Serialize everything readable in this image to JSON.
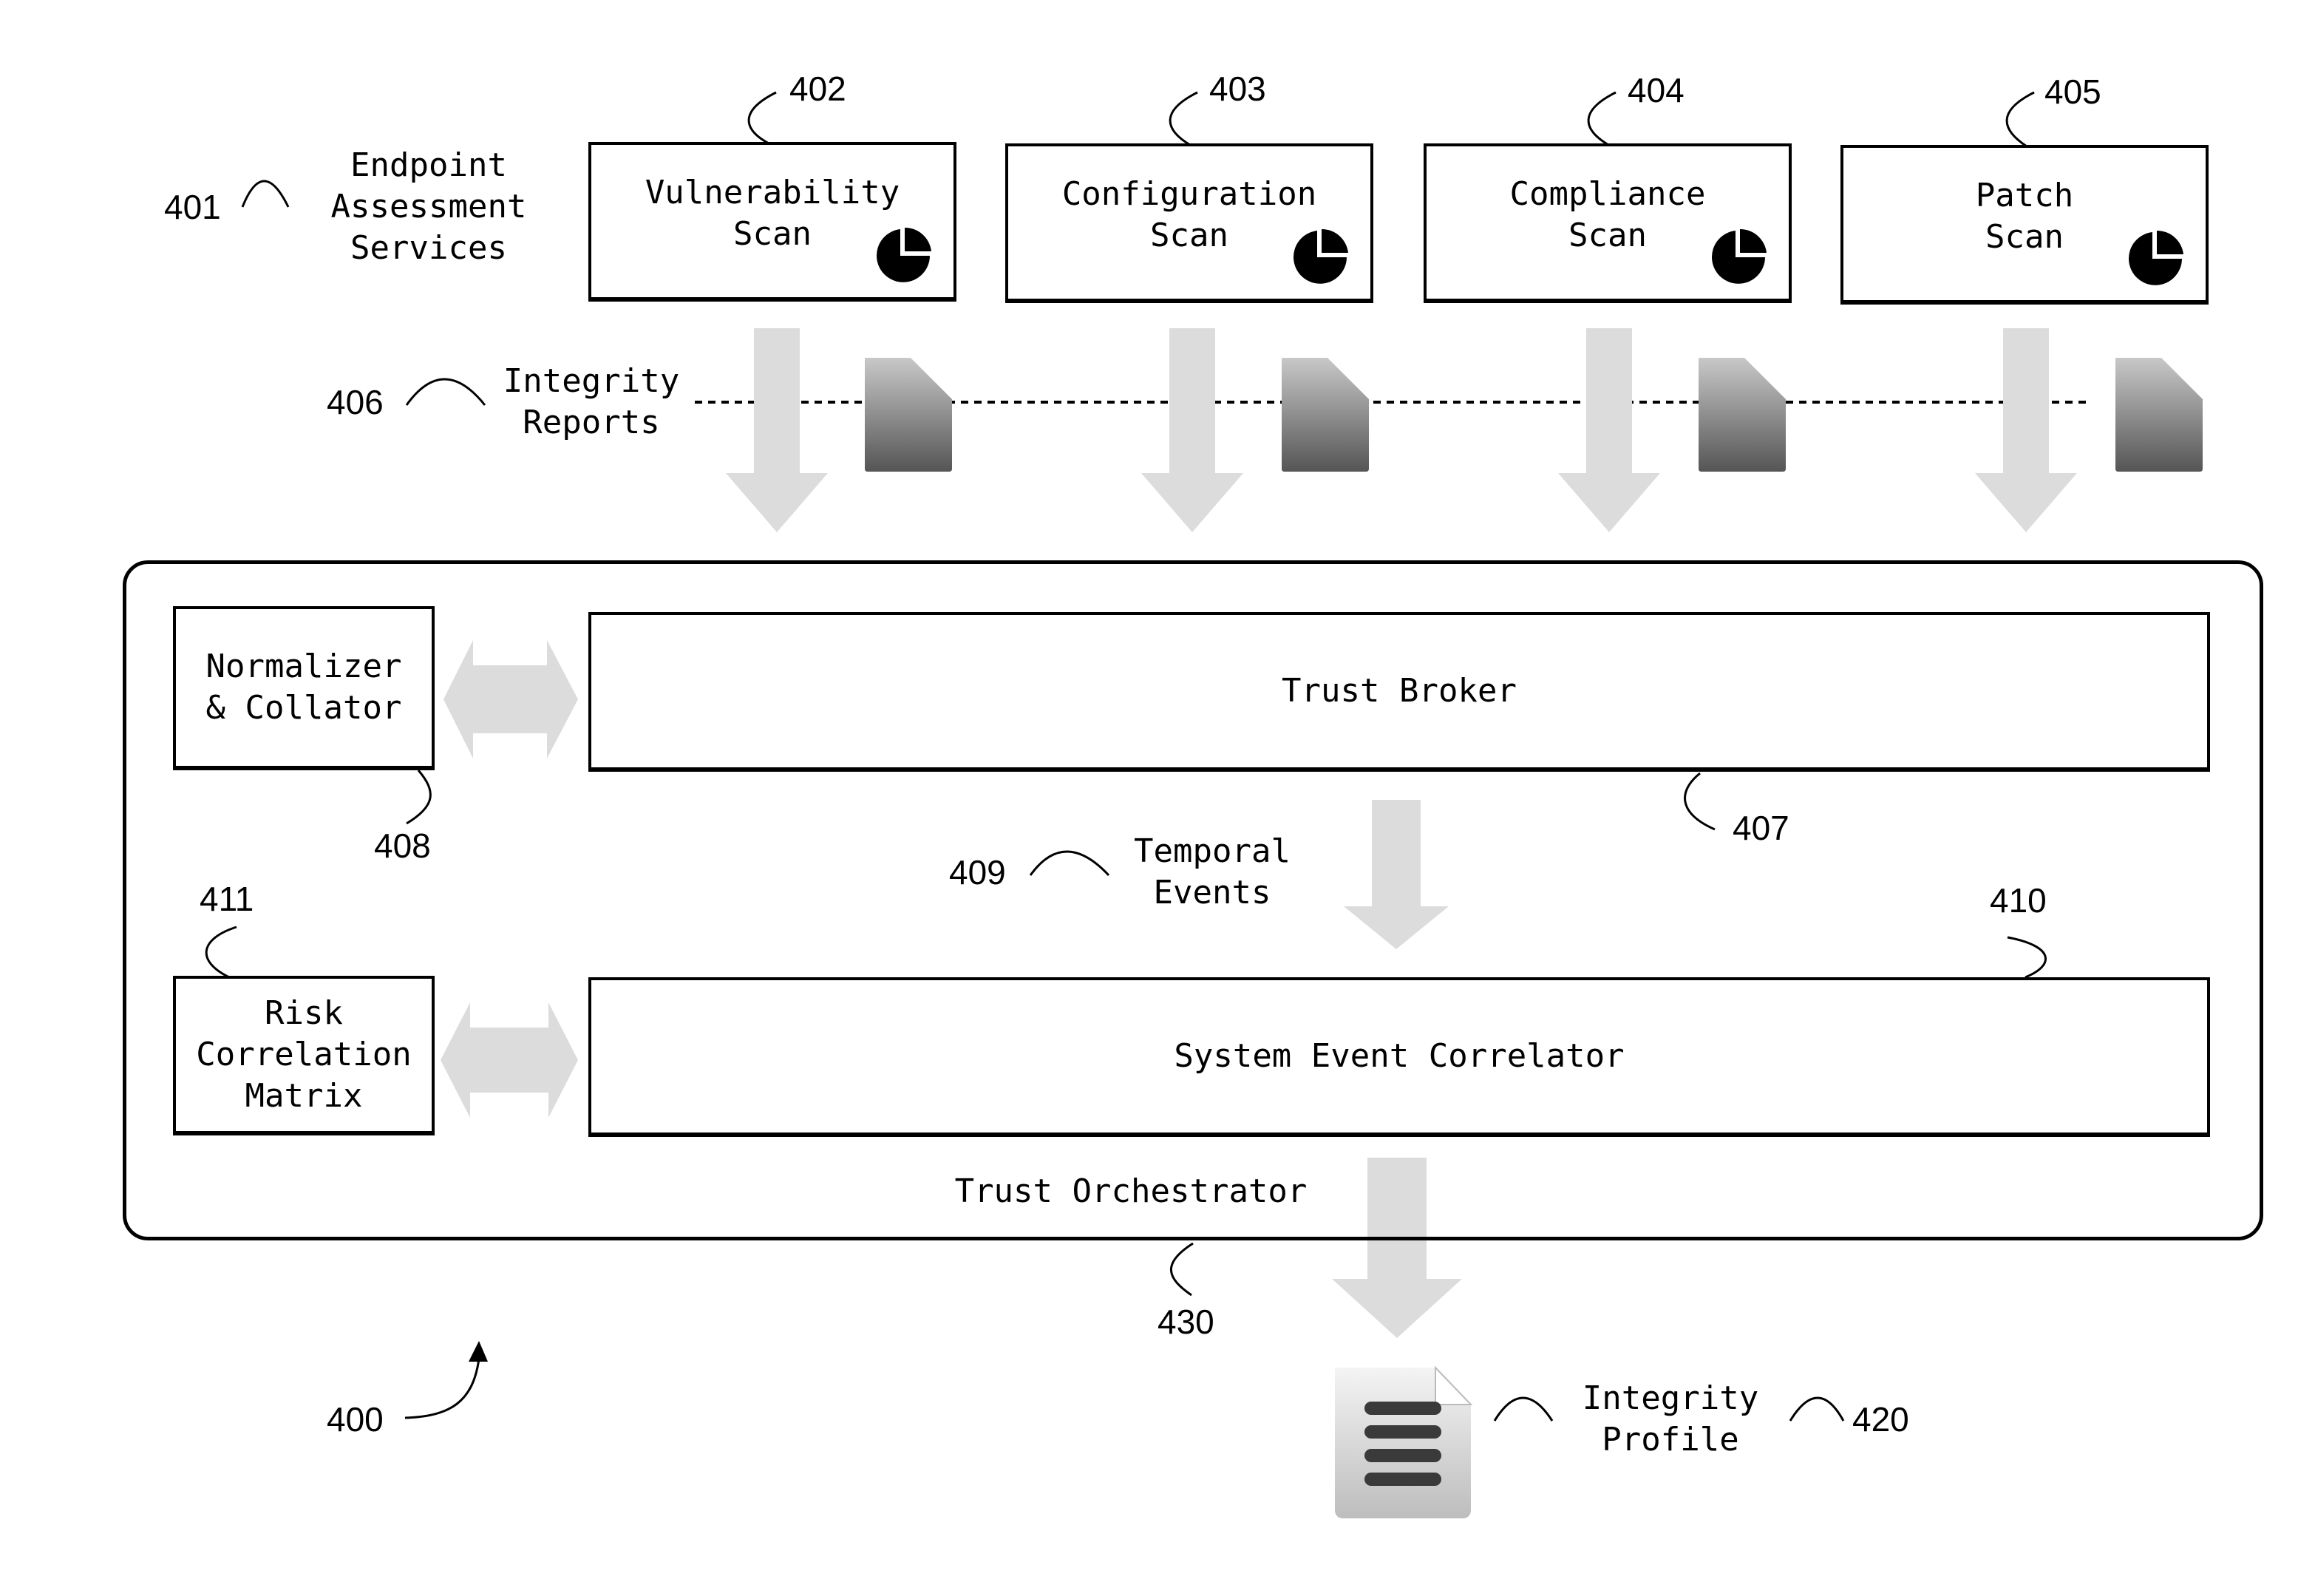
{
  "diagram": {
    "figure_ref": "400",
    "assessment": {
      "ref": "401",
      "label": "Endpoint\nAssessment\nServices",
      "scans": [
        {
          "ref": "402",
          "label": "Vulnerability\nScan",
          "icon": "pie-chart-icon"
        },
        {
          "ref": "403",
          "label": "Configuration\nScan",
          "icon": "pie-chart-icon"
        },
        {
          "ref": "404",
          "label": "Compliance\nScan",
          "icon": "pie-chart-icon"
        },
        {
          "ref": "405",
          "label": "Patch\nScan",
          "icon": "pie-chart-icon"
        }
      ]
    },
    "integrity_reports": {
      "ref": "406",
      "label": "Integrity\nReports",
      "icon": "document-icon"
    },
    "trust_orchestrator": {
      "ref": "430",
      "label": "Trust Orchestrator",
      "normalizer": {
        "ref": "408",
        "label": "Normalizer\n& Collator"
      },
      "trust_broker": {
        "ref": "407",
        "label": "Trust Broker"
      },
      "temporal_events": {
        "ref": "409",
        "label": "Temporal\nEvents"
      },
      "risk_matrix": {
        "ref": "411",
        "label": "Risk\nCorrelation\nMatrix"
      },
      "event_correlator": {
        "ref": "410",
        "label": "System Event Correlator"
      }
    },
    "integrity_profile": {
      "ref": "420",
      "label": "Integrity\nProfile",
      "icon": "profile-document-icon"
    }
  },
  "colors": {
    "line": "#000000",
    "arrow_fill": "#d9d9d9",
    "doc_dark": "#555555",
    "doc_light": "#c8c8c8"
  }
}
